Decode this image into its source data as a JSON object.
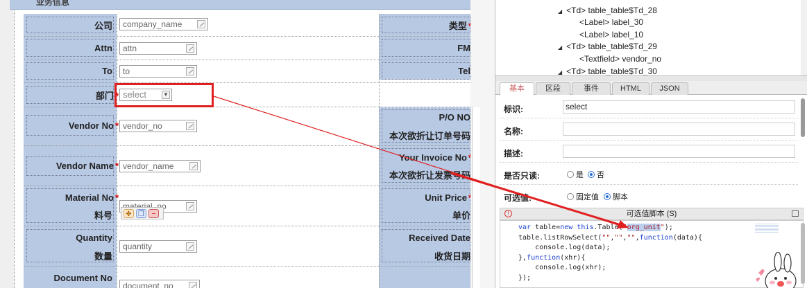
{
  "form": {
    "header_label": "业务信息",
    "rows": [
      {
        "label": "公司",
        "required": false,
        "field": "company_name"
      },
      {
        "label": "Attn",
        "required": false,
        "field": "attn"
      },
      {
        "label": "To",
        "required": false,
        "field": "to"
      },
      {
        "label": "部门",
        "required": true,
        "field": "select"
      },
      {
        "label": "Vendor No",
        "required": true,
        "field": "vendor_no"
      },
      {
        "label": "Vendor Name",
        "required": true,
        "field": "vendor_name"
      },
      {
        "label": "Material No",
        "sub_label": "料号",
        "required": true,
        "field": "material_no"
      },
      {
        "label": "Quantity",
        "sub_label": "数量",
        "required": false,
        "field": "quantity"
      },
      {
        "label": "Document No",
        "required": false,
        "field": "document_no"
      }
    ],
    "right_labels": [
      {
        "label": "类型",
        "required": true
      },
      {
        "label": "FM",
        "required": false
      },
      {
        "label": "Tel",
        "required": false
      },
      {
        "label": "P/O NO",
        "sub_label": "本次欲折让订单号码",
        "required": false
      },
      {
        "label": "Your Invoice No",
        "sub_label": "本次欲折让发票号码",
        "required": true
      },
      {
        "label": "Unit Price",
        "sub_label": "单价",
        "required": true
      },
      {
        "label": "Received Date",
        "sub_label": "收货日期",
        "required": false
      }
    ]
  },
  "tree": {
    "nodes": [
      {
        "text": "<Td> table_table$Td_28",
        "expanded": true
      },
      {
        "text": "<Label> label_30",
        "expanded": false
      },
      {
        "text": "<Label> label_10",
        "expanded": false
      },
      {
        "text": "<Td> table_table$Td_29",
        "expanded": true
      },
      {
        "text": "<Textfield> vendor_no",
        "expanded": false
      },
      {
        "text": "<Td> table_table$Td_30",
        "expanded": true
      }
    ]
  },
  "tabs": [
    "基本",
    "区段",
    "事件",
    "HTML",
    "JSON"
  ],
  "active_tab": "基本",
  "props": {
    "id_label": "标识:",
    "id_value": "select",
    "name_label": "名称:",
    "name_value": "",
    "desc_label": "描述:",
    "desc_value": "",
    "readonly_label": "是否只读:",
    "readonly_options": [
      "是",
      "否"
    ],
    "readonly_selected": "否",
    "options_label": "可选值:",
    "options_options": [
      "固定值",
      "脚本"
    ],
    "options_selected": "脚本"
  },
  "script": {
    "title": "可选值脚本 (S)",
    "lines": [
      "var table=new this.Table(\"org_unit\");",
      "table.listRowSelect(\"\",\"\",\"\",function(data){",
      "    console.log(data);",
      "},function(xhr){",
      "    console.log(xhr);",
      "});"
    ]
  },
  "colors": {
    "label_bg": "#b8c9e4",
    "highlight": "#e02020",
    "required": "#d40000",
    "radio": "#2a6fd6"
  }
}
